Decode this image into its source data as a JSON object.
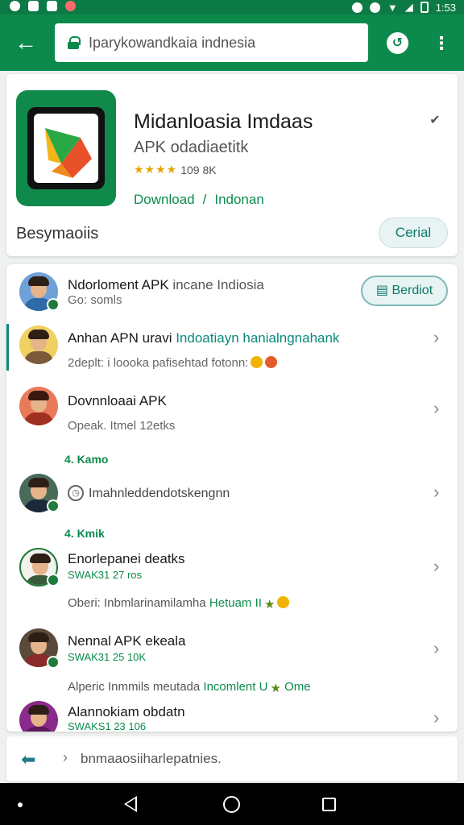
{
  "status_bar": {
    "time": "1:53"
  },
  "app_bar": {
    "url": "Iparykowandkaia indnesia",
    "back_icon": "arrow-left-icon",
    "history_icon": "history-icon",
    "menu_icon": "more-vert-icon"
  },
  "app_card": {
    "name": "Midanloasia Imdaas",
    "subtitle": "APK odadiaetitk",
    "rating_text": "109 8K",
    "stars": 4,
    "link_download": "Download",
    "link_separator": "/",
    "link_region": "Indonan",
    "meta": "Besymaoiis",
    "cancel_label": "Cerial"
  },
  "feed": {
    "send_label": "Berdiot",
    "items": [
      {
        "title": "Ndorloment APK",
        "title_rest": "incane Indiosia",
        "sub": "Go: somls"
      },
      {
        "title": "Anhan APN uravi",
        "title_hl": "Indoatiayn hanialngnahank",
        "sub": "2deplt: i loooka pafisehtad fotonn:"
      },
      {
        "title": "Dovnnloaai APK",
        "sub": "Opeak. Itmel 12etks"
      },
      {
        "section": "4. Kamo",
        "title": "Imahnleddendotskengnn"
      },
      {
        "section": "4. Kmik",
        "title": "Enorlepanei deatks",
        "sub": "SWAK31 27 ros",
        "extra": "Oberi: Inbmlarinamilamha",
        "extra_hl": "Hetuam II"
      },
      {
        "title": "Nennal APK ekeala",
        "sub": "SWAK31 25 10K",
        "extra": "Alperic Inmmils meutada",
        "extra_hl": "Incomlent U",
        "extra_tail": "Ome"
      },
      {
        "title": "Alannokiam obdatn",
        "sub": "SWAKS1 23 106"
      }
    ]
  },
  "input_bar": {
    "text": "bnmaaosiiharlepatnies."
  },
  "colors": {
    "brand": "#0c8a4c",
    "accent": "#0a8a7a"
  }
}
